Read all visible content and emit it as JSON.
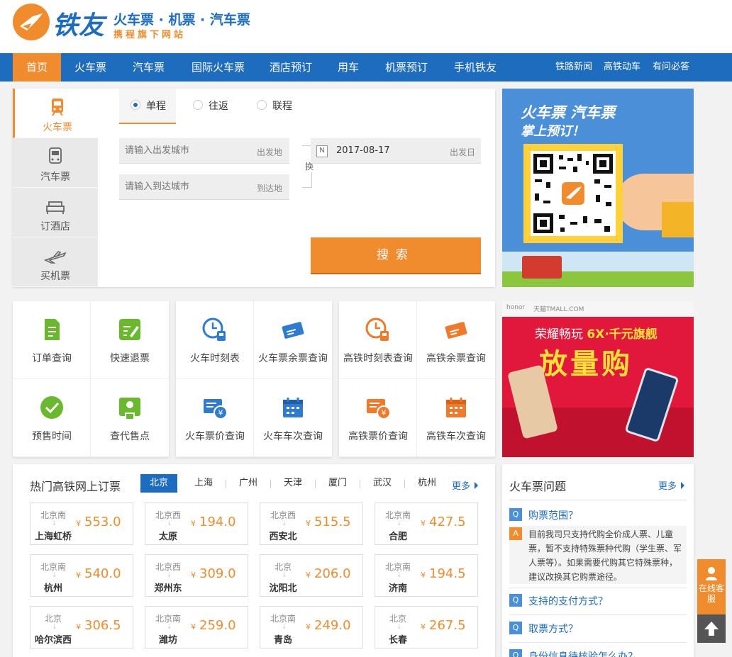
{
  "header": {
    "logo_name": "铁友",
    "slogan": "火车票 · 机票 · 汽车票",
    "sub": "携程旗下网站"
  },
  "nav": {
    "items": [
      "首页",
      "火车票",
      "汽车票",
      "国际火车票",
      "酒店预订",
      "用车",
      "机票预订",
      "手机铁友"
    ],
    "right_items": [
      "铁路新闻",
      "高铁动车",
      "有问必答"
    ]
  },
  "search": {
    "side_tabs": [
      "火车票",
      "汽车票",
      "订酒店",
      "买机票"
    ],
    "trip_types": [
      "单程",
      "往返",
      "联程"
    ],
    "from_placeholder": "请输入出发城市",
    "from_suffix": "出发地",
    "to_placeholder": "请输入到达城市",
    "to_suffix": "到达地",
    "swap_label": "换",
    "date_icon": "N",
    "date_value": "2017-08-17",
    "date_suffix": "出发日",
    "button": "搜索"
  },
  "ad_qr": {
    "line1": "火车票 汽车票",
    "line2": "掌上预订！"
  },
  "quick_links": [
    {
      "label": "订单查询",
      "icon": "document-icon"
    },
    {
      "label": "快速退票",
      "icon": "edit-icon"
    },
    {
      "label": "预售时间",
      "icon": "check-circle-icon"
    },
    {
      "label": "查代售点",
      "icon": "map-pin-icon"
    },
    {
      "label": "火车时刻表",
      "icon": "clock-train-icon"
    },
    {
      "label": "火车票余票查询",
      "icon": "ticket-icon"
    },
    {
      "label": "火车票价查询",
      "icon": "yuan-card-icon"
    },
    {
      "label": "火车车次查询",
      "icon": "calendar-icon"
    },
    {
      "label": "高铁时刻表查询",
      "icon": "clock-train-icon"
    },
    {
      "label": "高铁余票查询",
      "icon": "ticket-icon"
    },
    {
      "label": "高铁票价查询",
      "icon": "yuan-card-icon"
    },
    {
      "label": "高铁车次查询",
      "icon": "calendar-icon"
    }
  ],
  "ad_phone": {
    "brand_left": "honor",
    "brand_right": "天猫TMALL.COM",
    "line1_a": "荣耀畅玩",
    "line1_b": "6X·千元旗舰",
    "line2": "放量购"
  },
  "hot": {
    "title": "热门高铁网上订票",
    "cities": [
      "北京",
      "上海",
      "广州",
      "天津",
      "厦门",
      "武汉",
      "杭州"
    ],
    "more": "更多",
    "currency": "¥",
    "tickets": [
      {
        "from": "北京南",
        "to": "上海虹桥",
        "price": "553.0"
      },
      {
        "from": "北京西",
        "to": "太原",
        "price": "194.0"
      },
      {
        "from": "北京西",
        "to": "西安北",
        "price": "515.5"
      },
      {
        "from": "北京南",
        "to": "合肥",
        "price": "427.5"
      },
      {
        "from": "北京南",
        "to": "杭州",
        "price": "540.0"
      },
      {
        "from": "北京西",
        "to": "郑州东",
        "price": "309.0"
      },
      {
        "from": "北京",
        "to": "沈阳北",
        "price": "206.0"
      },
      {
        "from": "北京南",
        "to": "济南",
        "price": "194.5"
      },
      {
        "from": "北京",
        "to": "哈尔滨西",
        "price": "306.5"
      },
      {
        "from": "北京南",
        "to": "潍坊",
        "price": "259.0"
      },
      {
        "from": "北京南",
        "to": "青岛",
        "price": "249.0"
      },
      {
        "from": "北京",
        "to": "长春",
        "price": "267.5"
      }
    ]
  },
  "faq": {
    "title": "火车票问题",
    "more": "更多",
    "q_badge": "Q",
    "a_badge": "A",
    "q1": "购票范围？",
    "a1": "目前我司只支持代购全价成人票、儿童票，暂不支持特殊票种代购（学生票、军人票等）。如果需要代购其它特殊票种，建议改换其它购票途径。",
    "q2": "支持的支付方式？",
    "q3": "取票方式？",
    "q4": "身份信息待核验怎么办？"
  },
  "float": {
    "service": "在线客服"
  }
}
